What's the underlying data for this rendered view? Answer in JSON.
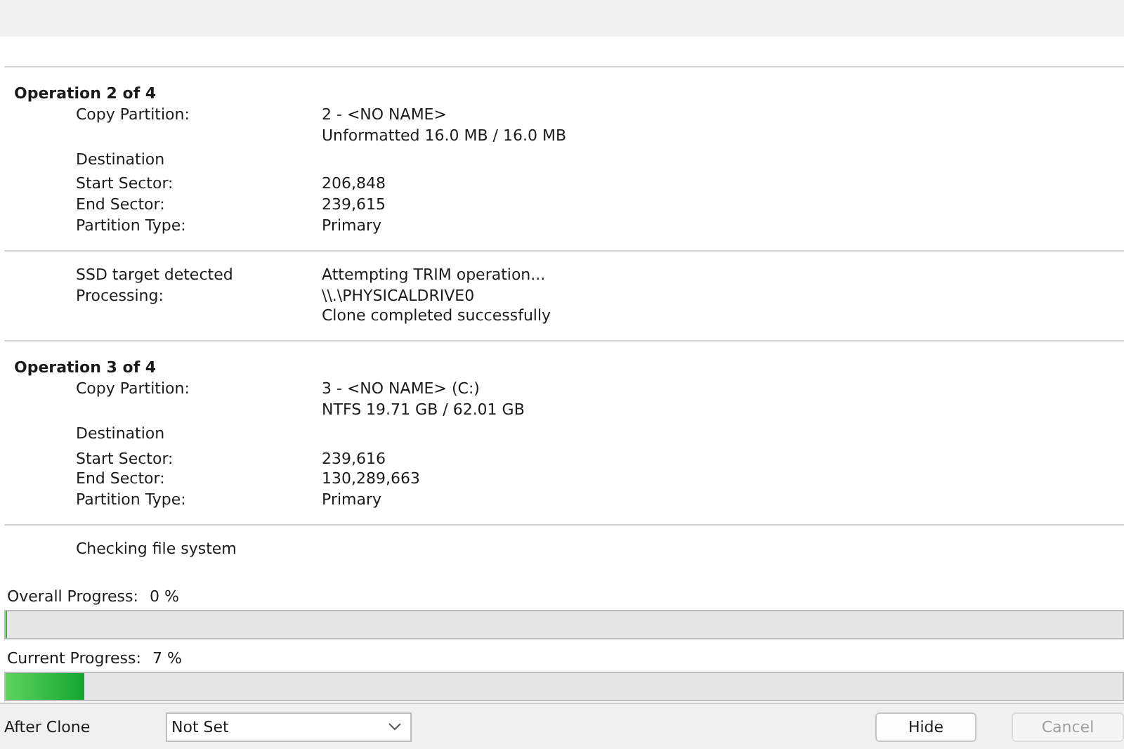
{
  "log": {
    "sections": [
      {
        "title": "Operation 2 of 4",
        "rows": [
          {
            "label": "Copy Partition:",
            "values": [
              "2 - <NO NAME>",
              "Unformatted 16.0 MB / 16.0 MB"
            ]
          },
          {
            "label": "Destination",
            "values": [],
            "kind": "heading"
          },
          {
            "label": "Start Sector:",
            "values": [
              "206,848"
            ]
          },
          {
            "label": "End Sector:",
            "values": [
              "239,615"
            ]
          },
          {
            "label": "Partition Type:",
            "values": [
              "Primary"
            ]
          }
        ]
      },
      {
        "rows": [
          {
            "label": "SSD target detected",
            "values": [
              "Attempting TRIM operation..."
            ]
          },
          {
            "label": "Processing:",
            "values": [
              "\\\\.\\PHYSICALDRIVE0",
              "Clone completed successfully"
            ]
          }
        ]
      },
      {
        "title": "Operation 3 of 4",
        "rows": [
          {
            "label": "Copy Partition:",
            "values": [
              "3 - <NO NAME> (C:)",
              "NTFS 19.71 GB / 62.01 GB"
            ]
          },
          {
            "label": "Destination",
            "values": [],
            "kind": "heading"
          },
          {
            "label": "Start Sector:",
            "values": [
              "239,616"
            ]
          },
          {
            "label": "End Sector:",
            "values": [
              "130,289,663"
            ]
          },
          {
            "label": "Partition Type:",
            "values": [
              "Primary"
            ]
          }
        ]
      },
      {
        "rows": [
          {
            "label": "Checking file system",
            "values": []
          }
        ]
      }
    ]
  },
  "progress": [
    {
      "label": "Overall Progress:",
      "reading": "0 %",
      "level": 0
    },
    {
      "label": "Current Progress:",
      "reading": "7 %",
      "level": 0.07
    }
  ],
  "footer": {
    "label": "After Clone",
    "select": "Not Set",
    "buttons": [
      {
        "label": "Hide",
        "disabled": false
      },
      {
        "label": "Cancel",
        "disabled": true
      }
    ]
  }
}
